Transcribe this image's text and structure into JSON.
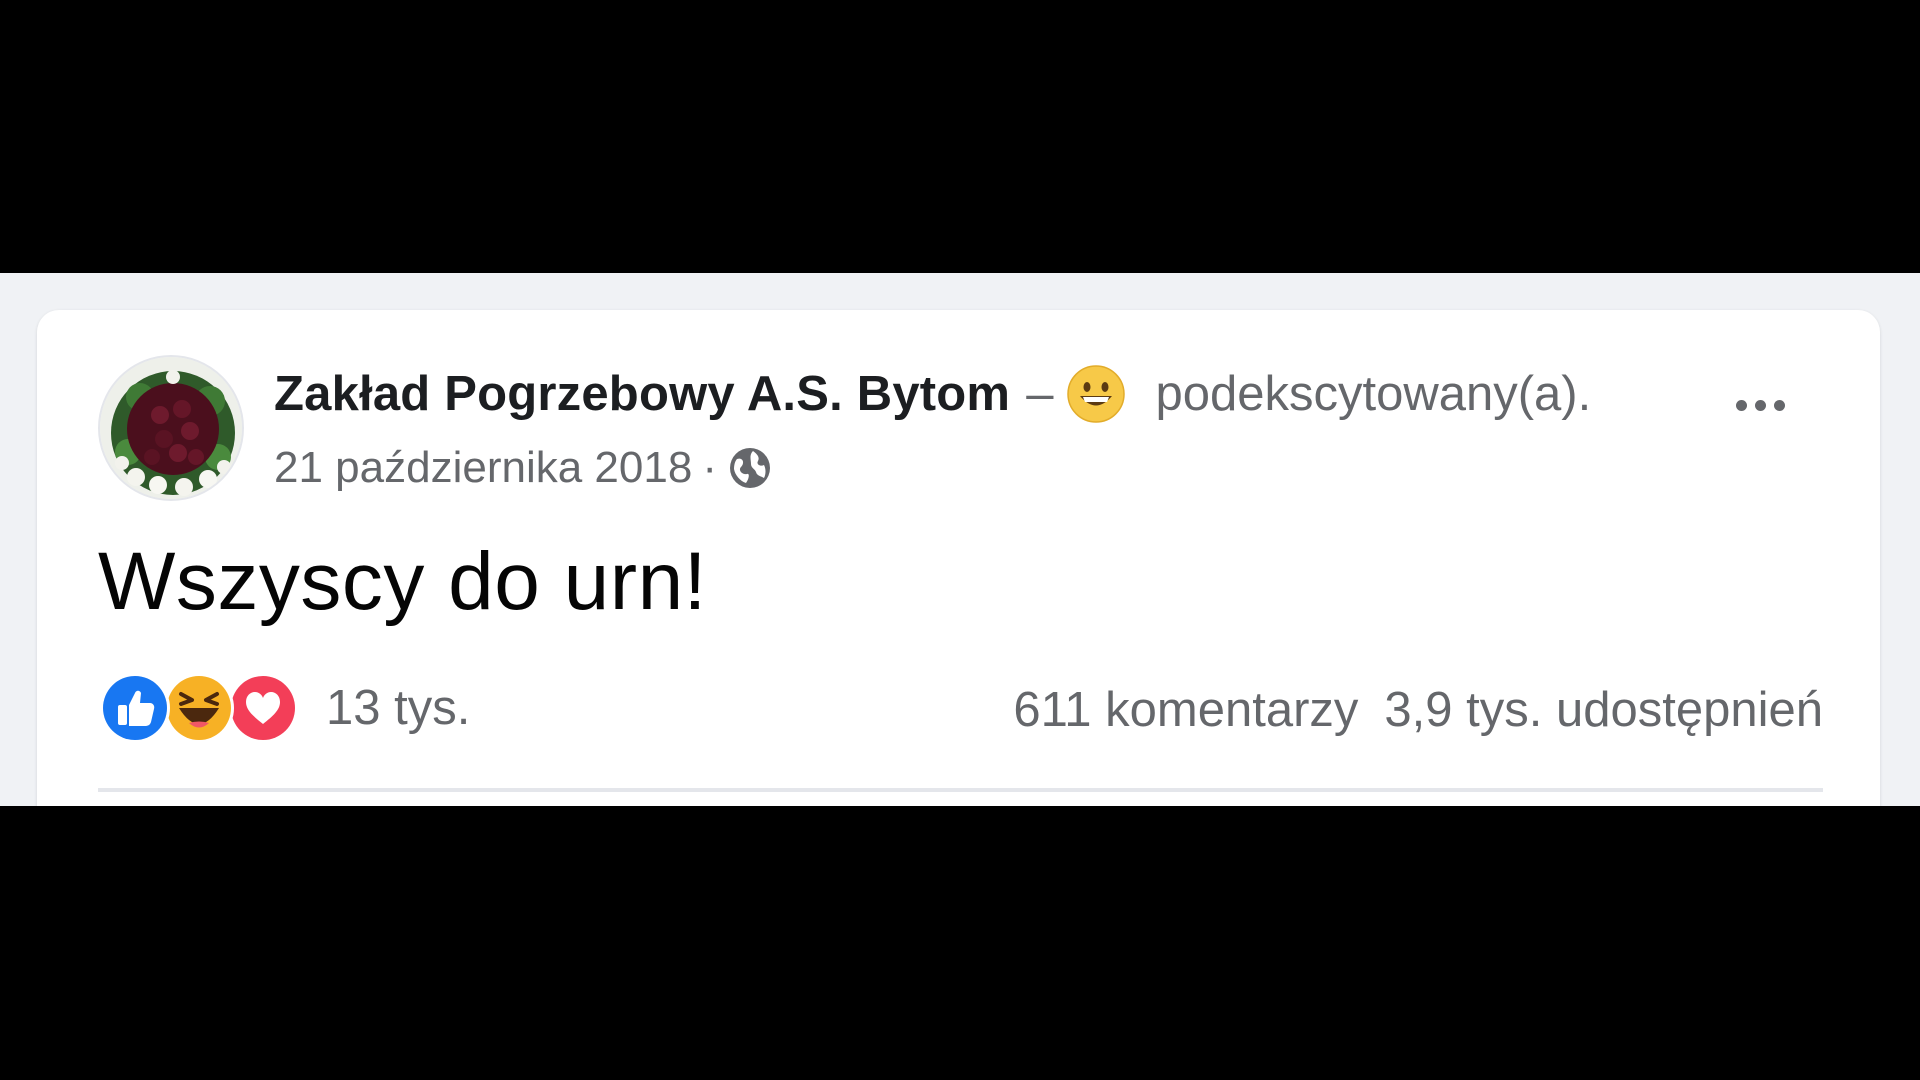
{
  "post": {
    "page_name": "Zakład Pogrzebowy A.S. Bytom",
    "separator": "–",
    "feeling_icon": "grinning-face-emoji",
    "feeling_text": "podekscytowany(a).",
    "date": "21 października 2018",
    "meta_separator": "·",
    "audience_icon": "globe-icon",
    "text": "Wszyscy do urn!"
  },
  "reactions": {
    "icons": [
      "like-icon",
      "haha-icon",
      "love-icon"
    ],
    "count": "13 tys."
  },
  "stats": {
    "comments": "611 komentarzy",
    "shares": "3,9 tys. udostępnień"
  },
  "colors": {
    "like": "#1877f2",
    "love": "#f33e58",
    "haha": "#f7b125",
    "secondary_text": "#65676b",
    "primary_text": "#050505",
    "background": "#f0f2f5"
  }
}
